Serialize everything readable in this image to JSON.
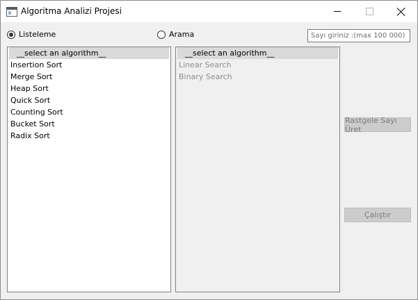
{
  "window": {
    "title": "Algoritma Analizi Projesi"
  },
  "mode": {
    "list_label": "Listeleme",
    "search_label": "Arama",
    "selected": "Listeleme"
  },
  "input": {
    "placeholder": "Sayı giriniz :(max 100 000)",
    "value": ""
  },
  "sort_list": {
    "header": "__select an algorithm__",
    "items": [
      "Insertion Sort",
      "Merge Sort",
      "Heap Sort",
      "Quick Sort",
      "Counting Sort",
      "Bucket Sort",
      "Radix Sort"
    ]
  },
  "search_list": {
    "header": "__select an algorithm__",
    "items": [
      "Linear Search",
      "Binary Search"
    ]
  },
  "buttons": {
    "random": "Rastgele Sayı Üret",
    "run": "Çalıştır"
  }
}
